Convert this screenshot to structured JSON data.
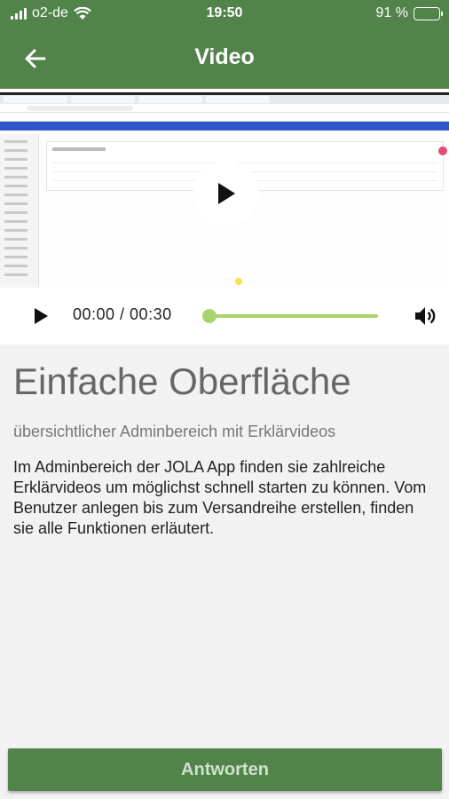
{
  "status_bar": {
    "carrier": "o2-de",
    "time": "19:50",
    "battery_text": "91 %",
    "battery_level_percent": 91
  },
  "header": {
    "title": "Video"
  },
  "video": {
    "current_time": "00:00",
    "duration": "00:30",
    "time_display": "00:00 / 00:30",
    "progress_percent": 0
  },
  "content": {
    "heading": "Einfache Oberfläche",
    "subtitle": "übersichtlicher Adminbereich mit Erklärvideos",
    "body": "Im Adminbereich der JOLA App finden sie zahlreiche Erklärvideos um möglichst schnell starten zu können. Vom Benutzer anlegen bis zum Versandreihe erstellen, finden sie alle Funktionen erläutert."
  },
  "footer": {
    "answer_label": "Antworten"
  },
  "colors": {
    "brand_green": "#51834a",
    "accent_lime": "#a8d46f"
  },
  "icons": [
    "wifi-icon",
    "back-arrow-icon",
    "play-icon",
    "volume-icon"
  ]
}
